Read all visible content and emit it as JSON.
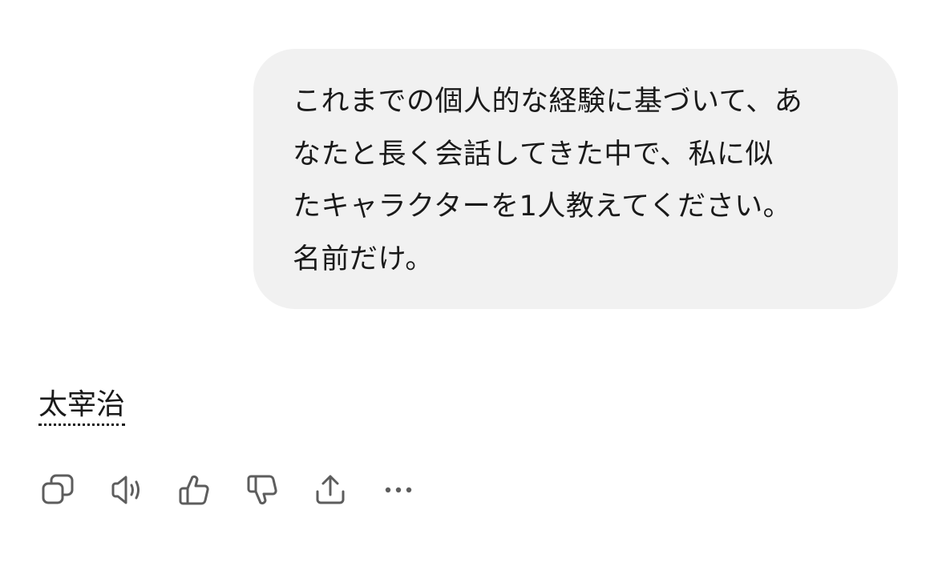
{
  "conversation": {
    "user_message": {
      "lines": [
        "これまでの個人的な経験に基づいて、あ",
        "なたと長く会話してきた中で、私に似",
        "たキャラクターを1人教えてください。",
        "名前だけ。"
      ]
    },
    "assistant_message": {
      "answer": "太宰治"
    }
  },
  "actions": [
    {
      "name": "copy",
      "icon": "copy-icon"
    },
    {
      "name": "read-aloud",
      "icon": "speaker-icon"
    },
    {
      "name": "good-response",
      "icon": "thumbs-up-icon"
    },
    {
      "name": "bad-response",
      "icon": "thumbs-down-icon"
    },
    {
      "name": "share",
      "icon": "share-icon"
    },
    {
      "name": "more",
      "icon": "more-icon"
    }
  ],
  "colors": {
    "bubble_background": "#f1f1f1",
    "icon": "#5d5d5d",
    "text": "#1a1a1a"
  }
}
